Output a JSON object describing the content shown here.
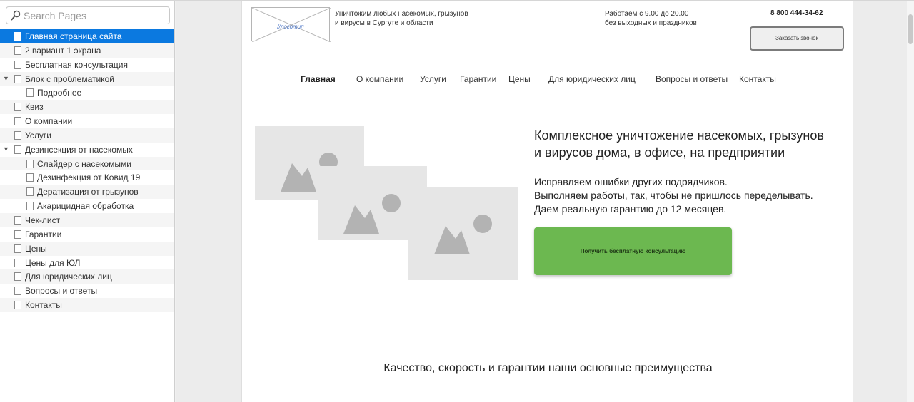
{
  "search": {
    "placeholder": "Search Pages",
    "value": ""
  },
  "pages": [
    {
      "label": "Главная страница сайта",
      "level": 0,
      "selected": true
    },
    {
      "label": "2 вариант 1 экрана",
      "level": 0
    },
    {
      "label": "Бесплатная консультация",
      "level": 0
    },
    {
      "label": "Блок с проблематикой",
      "level": 0,
      "expanded": true
    },
    {
      "label": "Подробнее",
      "level": 1
    },
    {
      "label": "Квиз",
      "level": 0
    },
    {
      "label": "О компании",
      "level": 0
    },
    {
      "label": "Услуги",
      "level": 0
    },
    {
      "label": "Дезинсекция от насекомых",
      "level": 0,
      "expanded": true
    },
    {
      "label": "Слайдер с насекомыми",
      "level": 1
    },
    {
      "label": "Дезинфекция от Ковид 19",
      "level": 1
    },
    {
      "label": "Дератизация от грызунов",
      "level": 1
    },
    {
      "label": "Акарицидная обработка",
      "level": 1
    },
    {
      "label": "Чек-лист",
      "level": 0
    },
    {
      "label": "Гарантии",
      "level": 0
    },
    {
      "label": "Цены",
      "level": 0
    },
    {
      "label": "Цены для ЮЛ",
      "level": 0
    },
    {
      "label": "Для юридических лиц",
      "level": 0
    },
    {
      "label": "Вопросы и ответы",
      "level": 0
    },
    {
      "label": "Контакты",
      "level": 0
    }
  ],
  "header": {
    "logo_text": "//логотип",
    "tagline_line1": "Уничтожим любых насекомых, грызунов",
    "tagline_line2": "и вирусы в Сургуте и области",
    "hours_line1": "Работаем с 9.00 до 20.00",
    "hours_line2": "без выходных и праздников",
    "phone": "8 800 444-34-62",
    "callback_button": "Заказать звонок"
  },
  "nav": [
    {
      "label": "Главная",
      "active": true
    },
    {
      "label": "О компании"
    },
    {
      "label": "Услуги"
    },
    {
      "label": "Гарантии"
    },
    {
      "label": "Цены"
    },
    {
      "label": "Для юридических лиц"
    },
    {
      "label": "Вопросы и ответы"
    },
    {
      "label": "Контакты"
    }
  ],
  "hero": {
    "title_line1": "Комплексное уничтожение насекомых, грызунов",
    "title_line2": "и вирусов дома, в офисе, на предприятии",
    "text_line1": "Исправляем ошибки других подрядчиков.",
    "text_line2": "Выполняем работы, так, чтобы не пришлось переделывать.",
    "text_line3": "Даем реальную гарантию до 12 месяцев.",
    "cta_button": "Получить бесплатную консультацию"
  },
  "section": {
    "title": "Качество, скорость и гарантии наши основные преимущества"
  },
  "colors": {
    "selected": "#0b79e0",
    "cta": "#6cb850",
    "placeholder_image": "#e6e6e6"
  }
}
